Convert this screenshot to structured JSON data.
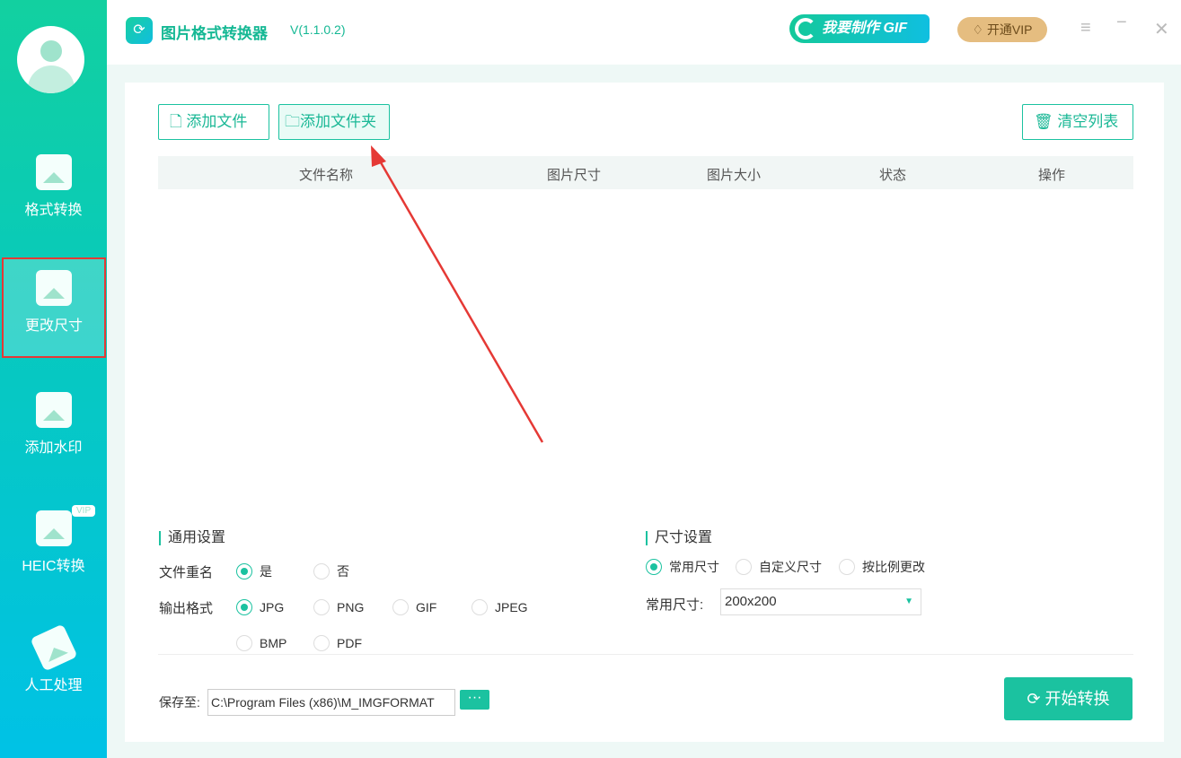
{
  "app": {
    "title": "图片格式转换器",
    "version": "V(1.1.0.2)"
  },
  "header": {
    "gif_label": "我要制作 GIF",
    "vip_label": "开通VIP",
    "menu": "≡",
    "minimize": "−",
    "close": "✕"
  },
  "sidebar": {
    "items": [
      {
        "label": "格式转换"
      },
      {
        "label": "更改尺寸"
      },
      {
        "label": "添加水印"
      },
      {
        "label": "HEIC转换",
        "badge": "VIP"
      },
      {
        "label": "人工处理"
      }
    ]
  },
  "toolbar": {
    "add_file": "添加文件",
    "add_folder": "添加文件夹",
    "clear_list": "清空列表"
  },
  "table": {
    "columns": [
      "文件名称",
      "图片尺寸",
      "图片大小",
      "状态",
      "操作"
    ]
  },
  "general": {
    "title": "通用设置",
    "rename_label": "文件重名",
    "rename_yes": "是",
    "rename_no": "否",
    "format_label": "输出格式",
    "formats": [
      "JPG",
      "PNG",
      "GIF",
      "JPEG",
      "BMP",
      "PDF"
    ]
  },
  "size": {
    "title": "尺寸设置",
    "modes": [
      "常用尺寸",
      "自定义尺寸",
      "按比例更改"
    ],
    "common_label": "常用尺寸:",
    "common_value": "200x200"
  },
  "footer": {
    "save_label": "保存至:",
    "save_path": "C:\\Program Files (x86)\\M_IMGFORMAT",
    "browse": "···",
    "start": "开始转换"
  },
  "colors": {
    "accent": "#1bc2a0",
    "annotation": "#e53935"
  }
}
